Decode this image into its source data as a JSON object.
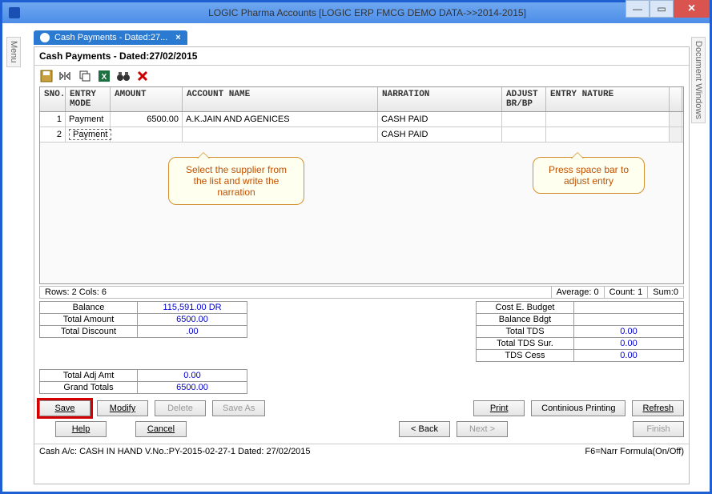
{
  "window": {
    "title": "LOGIC Pharma Accounts  [LOGIC ERP FMCG DEMO DATA->>2014-2015]"
  },
  "side_tabs": {
    "left": "Menu",
    "right": "Document Windows"
  },
  "tab": {
    "label": "Cash Payments - Dated:27...",
    "close": "×"
  },
  "panel_title": "Cash Payments - Dated:27/02/2015",
  "grid": {
    "headers": {
      "sno": "SNO.",
      "entry": "ENTRY MODE",
      "amount": "AMOUNT",
      "acct": "ACCOUNT NAME",
      "narr": "NARRATION",
      "adj": "ADJUST BR/BP",
      "nature": "ENTRY NATURE"
    },
    "rows": [
      {
        "sno": "1",
        "entry": "Payment",
        "amount": "6500.00",
        "acct": "A.K.JAIN AND AGENICES",
        "narr": "CASH PAID",
        "adj": "",
        "nature": ""
      },
      {
        "sno": "2",
        "entry": "Payment",
        "amount": "",
        "acct": "",
        "narr": "CASH PAID",
        "adj": "",
        "nature": ""
      }
    ],
    "stats": {
      "left": "Rows: 2  Cols: 6",
      "avg": "Average: 0",
      "count": "Count: 1",
      "sum": "Sum:0"
    }
  },
  "callouts": {
    "left": "Select the supplier from the list and write the narration",
    "right": "Press space bar to adjust entry"
  },
  "summary_left": [
    {
      "label": "Balance",
      "value": "115,591.00 DR"
    },
    {
      "label": "Total Amount",
      "value": "6500.00"
    },
    {
      "label": "Total Discount",
      "value": ".00"
    }
  ],
  "summary_left2": [
    {
      "label": "Total Adj Amt",
      "value": "0.00"
    },
    {
      "label": "Grand Totals",
      "value": "6500.00"
    }
  ],
  "summary_right": [
    {
      "label": "Cost E. Budget",
      "value": ""
    },
    {
      "label": "Balance Bdgt",
      "value": ""
    },
    {
      "label": "Total TDS",
      "value": "0.00"
    },
    {
      "label": "Total TDS Sur.",
      "value": "0.00"
    },
    {
      "label": "TDS Cess",
      "value": "0.00"
    }
  ],
  "buttons1": {
    "save": "Save",
    "modify": "Modify",
    "delete": "Delete",
    "saveas": "Save As",
    "print": "Print",
    "contprint": "Continious Printing",
    "refresh": "Refresh"
  },
  "buttons2": {
    "help": "Help",
    "cancel": "Cancel",
    "back": "< Back",
    "next": "Next >",
    "finish": "Finish"
  },
  "status": {
    "left": "Cash A/c: CASH IN HAND V.No.:PY-2015-02-27-1 Dated: 27/02/2015",
    "right": "F6=Narr Formula(On/Off)"
  }
}
